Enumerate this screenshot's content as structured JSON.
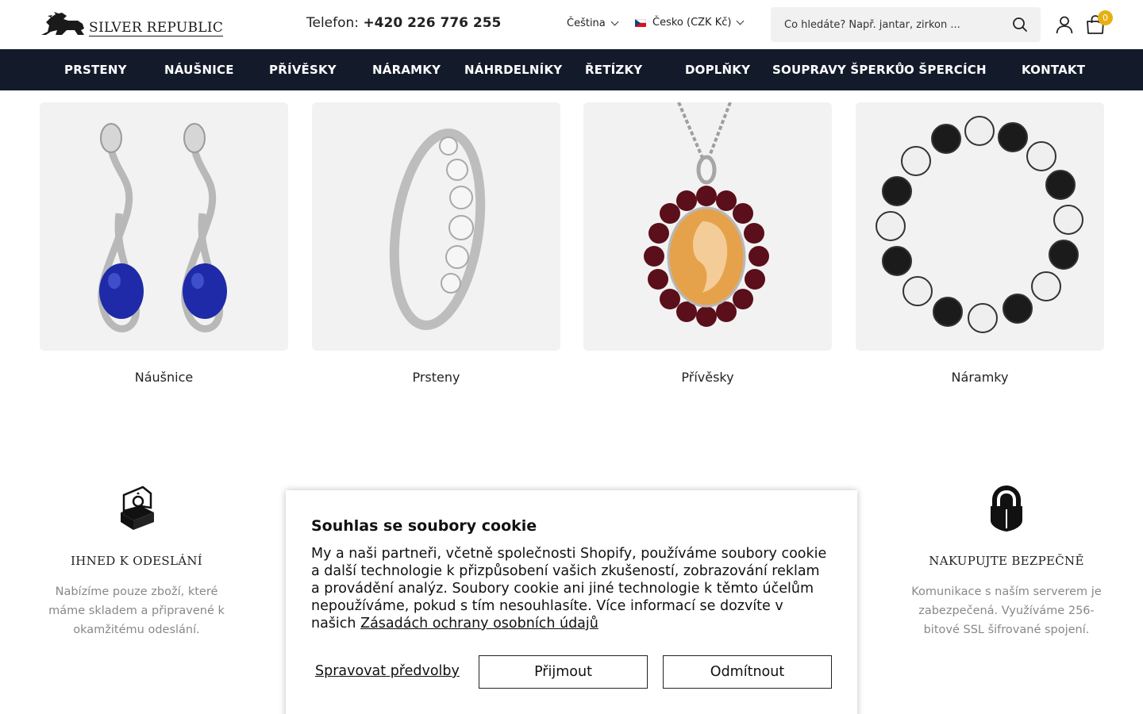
{
  "header": {
    "logo_text": "SILVER REPUBLIC",
    "phone_label": "Telefon:",
    "phone_number": "+420 226 776 255",
    "language": "Čeština",
    "country": "Česko (CZK Kč)",
    "search_placeholder": "Co hledáte? Např. jantar, zirkon ...",
    "cart_count": "0"
  },
  "nav": {
    "items": [
      "PRSTENY",
      "NÁUŠNICE",
      "PŘÍVĚSKY",
      "NÁRAMKY",
      "NÁHRDELNÍKY",
      "ŘETÍZKY",
      "DOPLŇKY",
      "SOUPRAVY ŠPERKŮ",
      "O ŠPERCÍCH",
      "KONTAKT"
    ]
  },
  "categories": [
    {
      "label": "Náušnice",
      "icon": "lapis-earrings-image"
    },
    {
      "label": "Prsteny",
      "icon": "zircon-ring-image"
    },
    {
      "label": "Přívěsky",
      "icon": "cameo-pendant-image"
    },
    {
      "label": "Náramky",
      "icon": "beaded-bracelet-image"
    }
  ],
  "features": [
    {
      "icon": "ring-box-icon",
      "title": "IHNED K ODESLÁNÍ",
      "desc": "Nabízíme pouze zboží, které máme skladem a připravené k okamžitému odeslání."
    },
    {
      "icon": "shield-lock-icon",
      "title": "NAKUPUJTE BEZPEČNĚ",
      "desc": "Komunikace s naším serverem je zabezpečená. Využíváme 256-bitové SSL šifrované spojení."
    }
  ],
  "cookie": {
    "title": "Souhlas se soubory cookie",
    "text": "My a naši partneři, včetně společnosti Shopify, používáme soubory cookie a další technologie k přizpůsobení vašich zkušeností, zobrazování reklam a provádění analýz. Soubory cookie ani jiné technologie k těmto účelům nepoužíváme, pokud s tím nesouhlasíte. Více informací se dozvíte v našich",
    "link": "Zásadách ochrany osobních údajů",
    "manage": "Spravovat předvolby",
    "accept": "Přijmout",
    "decline": "Odmítnout"
  },
  "colors": {
    "nav_bg": "#131b2b",
    "cart_badge": "#e6b012",
    "lapis": "#1f2aa8",
    "garnet": "#5a0f1a",
    "amber": "#e6a24a"
  }
}
